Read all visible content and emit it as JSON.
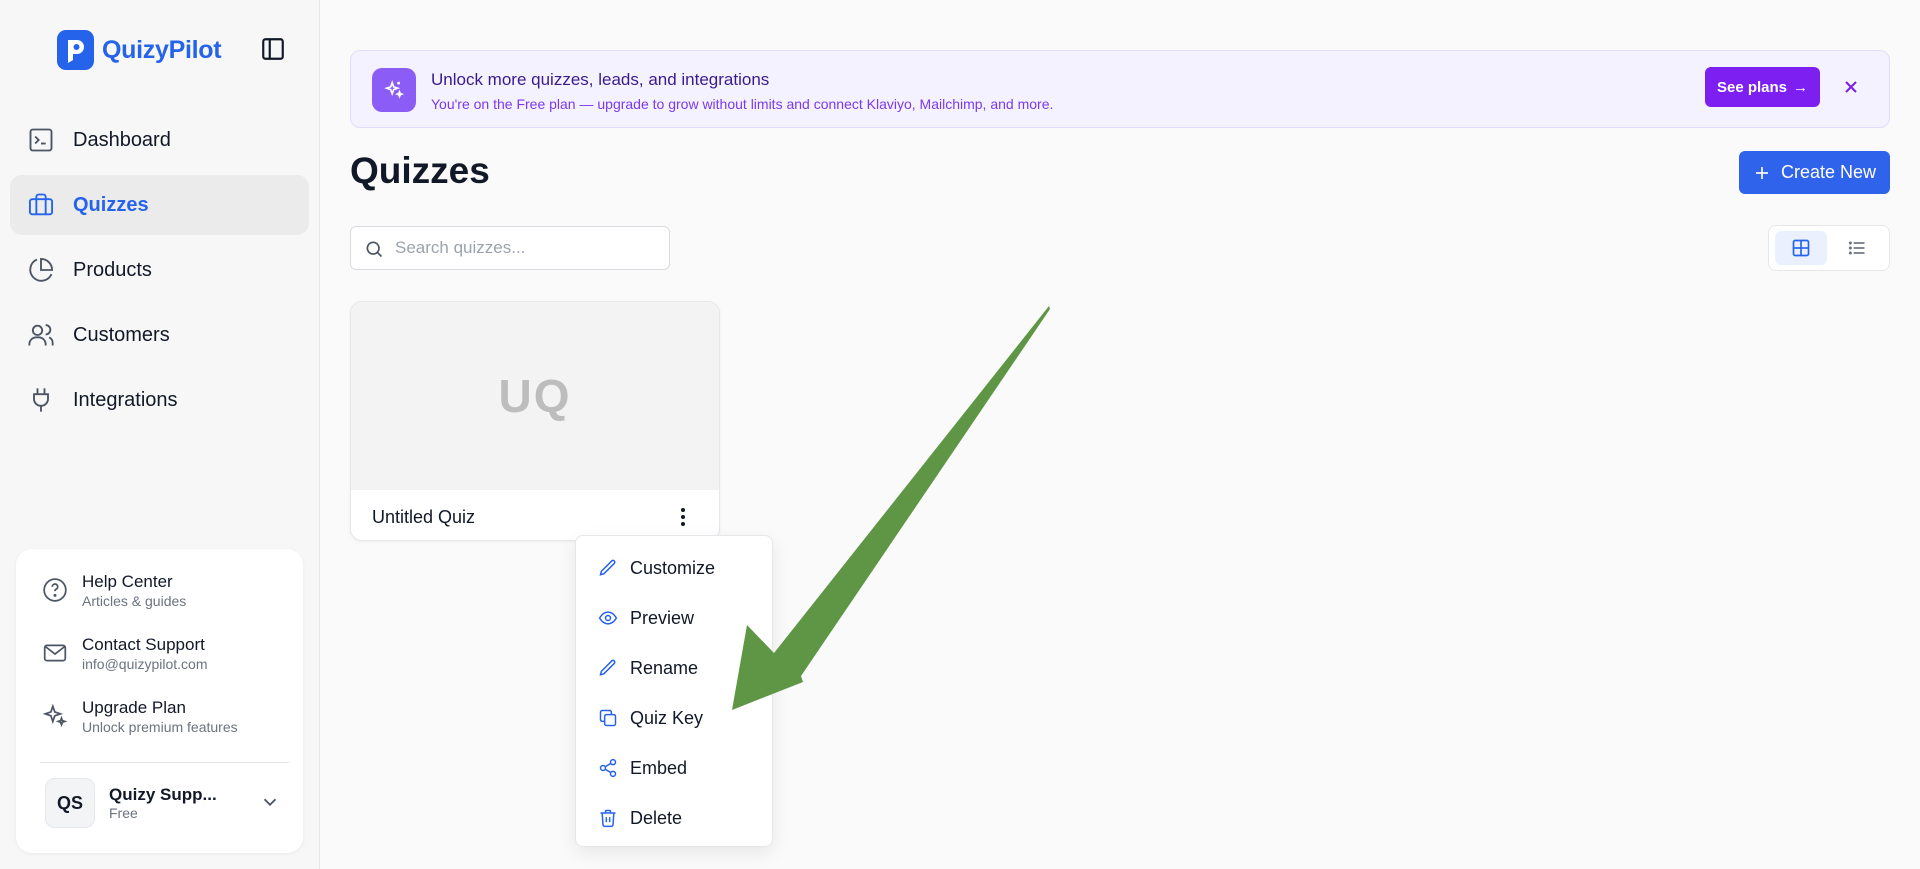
{
  "brand": {
    "name": "QuizyPilot"
  },
  "sidebar": {
    "items": [
      {
        "label": "Dashboard",
        "icon": "terminal-icon"
      },
      {
        "label": "Quizzes",
        "icon": "briefcase-icon",
        "active": true
      },
      {
        "label": "Products",
        "icon": "pie-chart-icon"
      },
      {
        "label": "Customers",
        "icon": "users-icon"
      },
      {
        "label": "Integrations",
        "icon": "plug-icon"
      }
    ],
    "help": [
      {
        "title": "Help Center",
        "subtitle": "Articles & guides",
        "icon": "help-circle-icon"
      },
      {
        "title": "Contact Support",
        "subtitle": "info@quizypilot.com",
        "icon": "mail-icon"
      },
      {
        "title": "Upgrade Plan",
        "subtitle": "Unlock premium features",
        "icon": "sparkles-icon"
      }
    ],
    "user": {
      "initials": "QS",
      "name": "Quizy Supp...",
      "plan": "Free"
    }
  },
  "banner": {
    "title": "Unlock more quizzes, leads, and integrations",
    "subtitle": "You're on the Free plan — upgrade to grow without limits and connect Klaviyo, Mailchimp, and more.",
    "cta": "See plans",
    "cta_arrow": "→",
    "close": "✕"
  },
  "main": {
    "title": "Quizzes",
    "create_label": "Create New",
    "search": {
      "placeholder": "Search quizzes...",
      "value": ""
    },
    "view_modes": [
      "grid",
      "list"
    ],
    "active_view": "grid"
  },
  "quizzes": [
    {
      "initials": "UQ",
      "name": "Untitled Quiz"
    }
  ],
  "context_menu": {
    "items": [
      {
        "label": "Customize",
        "icon": "pencil-icon"
      },
      {
        "label": "Preview",
        "icon": "eye-icon"
      },
      {
        "label": "Rename",
        "icon": "pencil-icon"
      },
      {
        "label": "Quiz Key",
        "icon": "copy-icon"
      },
      {
        "label": "Embed",
        "icon": "share-icon"
      },
      {
        "label": "Delete",
        "icon": "trash-icon"
      }
    ]
  },
  "colors": {
    "brand": "#2563eb",
    "upgrade_button": "#7c1ff0",
    "banner_accent": "#8b5cf6",
    "annotation_arrow": "#5e9645"
  }
}
